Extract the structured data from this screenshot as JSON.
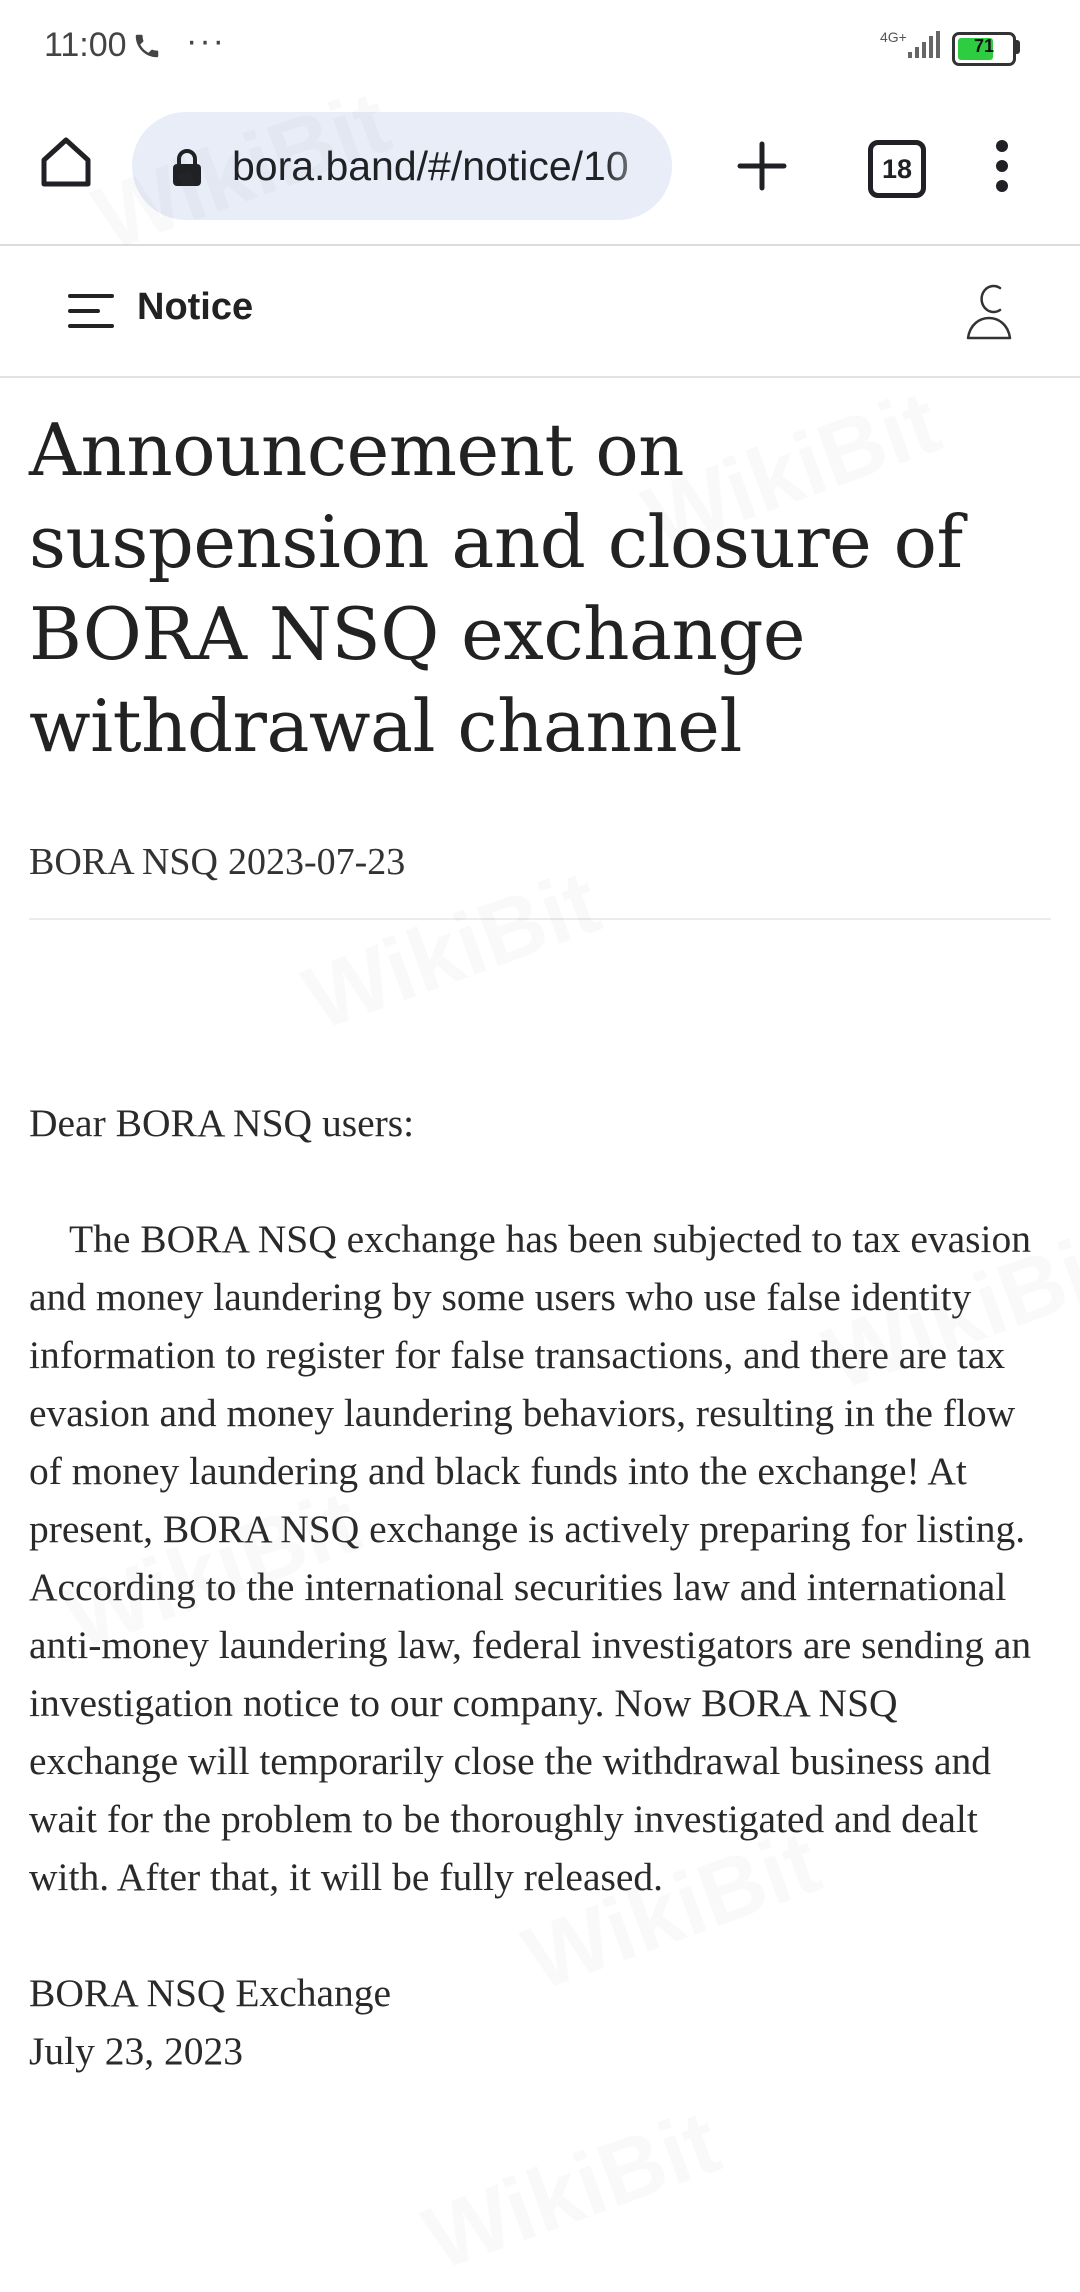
{
  "status_bar": {
    "time": "11:00",
    "more": "···",
    "network": "4G+",
    "battery_level": "71",
    "battery_percent": 71
  },
  "browser": {
    "url": "bora.band/#/notice/10",
    "tab_count": "18"
  },
  "site_header": {
    "title": "Notice"
  },
  "article": {
    "title": "Announcement on suspension and closure of BORA NSQ exchange withdrawal channel",
    "author": "BORA NSQ",
    "date": "2023-07-23",
    "greeting": "Dear BORA NSQ users:",
    "paragraph": "The BORA NSQ exchange has been subjected to tax evasion and money laundering by some users who use false identity information to register for false transactions, and there are tax evasion and money laundering behaviors, resulting in the flow of money laundering and black funds into the exchange! At present, BORA NSQ exchange is actively preparing for listing. According to the international securities law and international anti-money laundering law, federal investigators are sending an investigation notice to our company. Now BORA NSQ exchange will temporarily close the withdrawal business and wait for the problem to be thoroughly investigated and dealt with. After that, it will be fully released.",
    "signature_name": "BORA NSQ Exchange",
    "signature_date": "July 23, 2023"
  },
  "watermark": {
    "text": "WikiBit"
  },
  "colors": {
    "url_bar_bg": "#e8edf8",
    "battery_green": "#2ecc40",
    "text": "#222222"
  }
}
